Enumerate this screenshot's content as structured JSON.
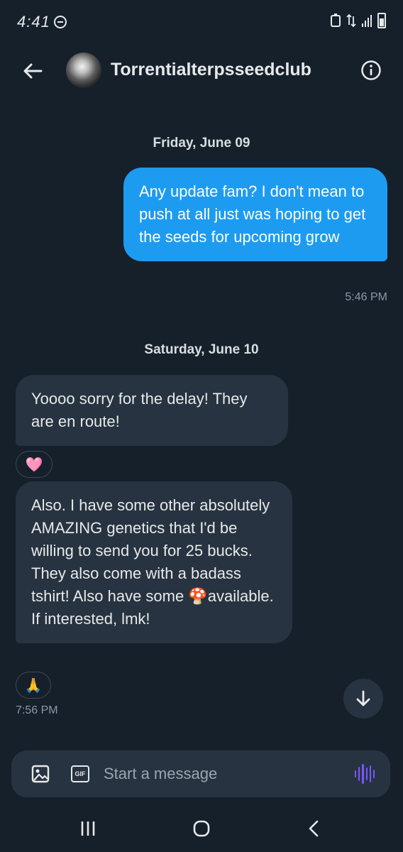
{
  "status_bar": {
    "time": "4:41"
  },
  "header": {
    "title": "Torrentialterpsseedclub"
  },
  "days": [
    {
      "date": "Friday, June 09"
    },
    {
      "date": "Saturday, June 10"
    }
  ],
  "messages": [
    {
      "direction": "outgoing",
      "text": "Any update fam? I don't mean to push at all just was hoping to get the seeds for upcoming grow",
      "time": "5:46 PM"
    },
    {
      "direction": "incoming",
      "text": "Yoooo sorry for the delay! They are en route!",
      "reaction": "🩷"
    },
    {
      "direction": "incoming",
      "text_before_emoji": "Also. I have some other absolutely AMAZING genetics that I'd be willing to send you for 25 bucks. They also come with a badass tshirt! Also have some ",
      "emoji": "🍄",
      "text_after_emoji": "available. If interested, lmk!",
      "reaction": "🙏",
      "time": "7:56 PM"
    }
  ],
  "composer": {
    "placeholder": "Start a message",
    "gif_label": "GIF"
  },
  "icons": {
    "back": "arrow-left-icon",
    "info": "info-circle-icon",
    "image": "image-icon",
    "gif": "gif-icon",
    "voice": "voice-waveform-icon",
    "scroll_down": "arrow-down-icon"
  },
  "colors": {
    "background": "#15202b",
    "outgoing_bubble": "#1d9bf0",
    "incoming_bubble": "#273340",
    "voice_accent": "#7856ff"
  }
}
